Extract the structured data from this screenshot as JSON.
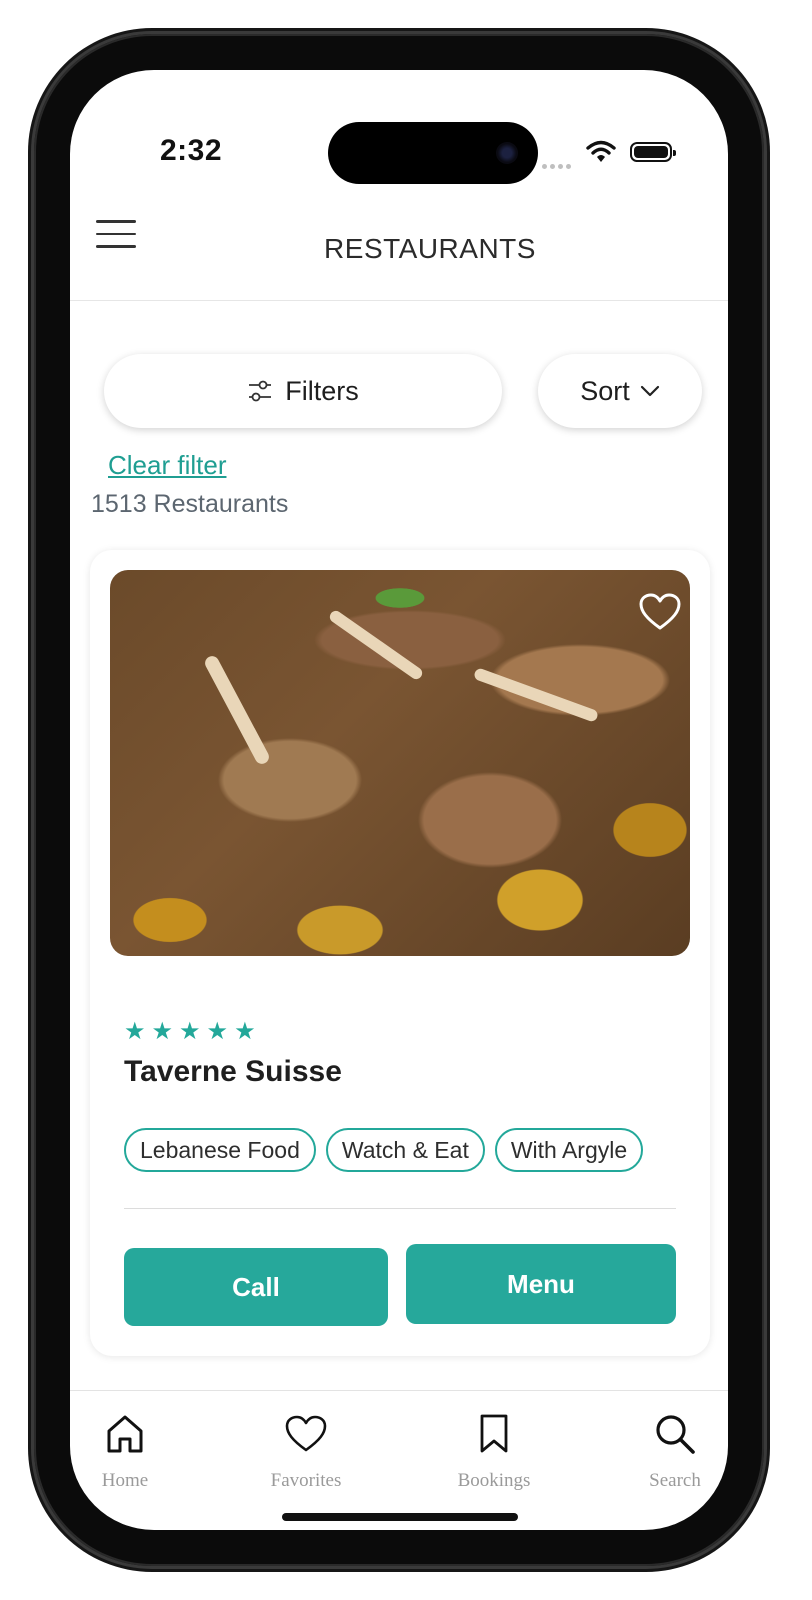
{
  "status_bar": {
    "time": "2:32"
  },
  "header": {
    "title": "RESTAURANTS"
  },
  "toolbar": {
    "filters_label": "Filters",
    "sort_label": "Sort",
    "clear_filter_label": "Clear filter",
    "count_text": "1513 Restaurants"
  },
  "restaurant": {
    "name": "Taverne Suisse",
    "rating": 5,
    "stars": [
      "★",
      "★",
      "★",
      "★",
      "★"
    ],
    "tags": [
      "Lebanese Food",
      "Watch & Eat",
      "With Argyle"
    ],
    "call_label": "Call",
    "menu_label": "Menu"
  },
  "tabbar": {
    "items": [
      {
        "label": "Home",
        "icon": "home-icon"
      },
      {
        "label": "Favorites",
        "icon": "heart-icon"
      },
      {
        "label": "Bookings",
        "icon": "bookmark-icon"
      },
      {
        "label": "Search",
        "icon": "search-icon"
      }
    ]
  },
  "colors": {
    "accent": "#26a89b",
    "link": "#1f9e92",
    "text": "#1f1f1f",
    "muted": "#9a9a9a"
  }
}
